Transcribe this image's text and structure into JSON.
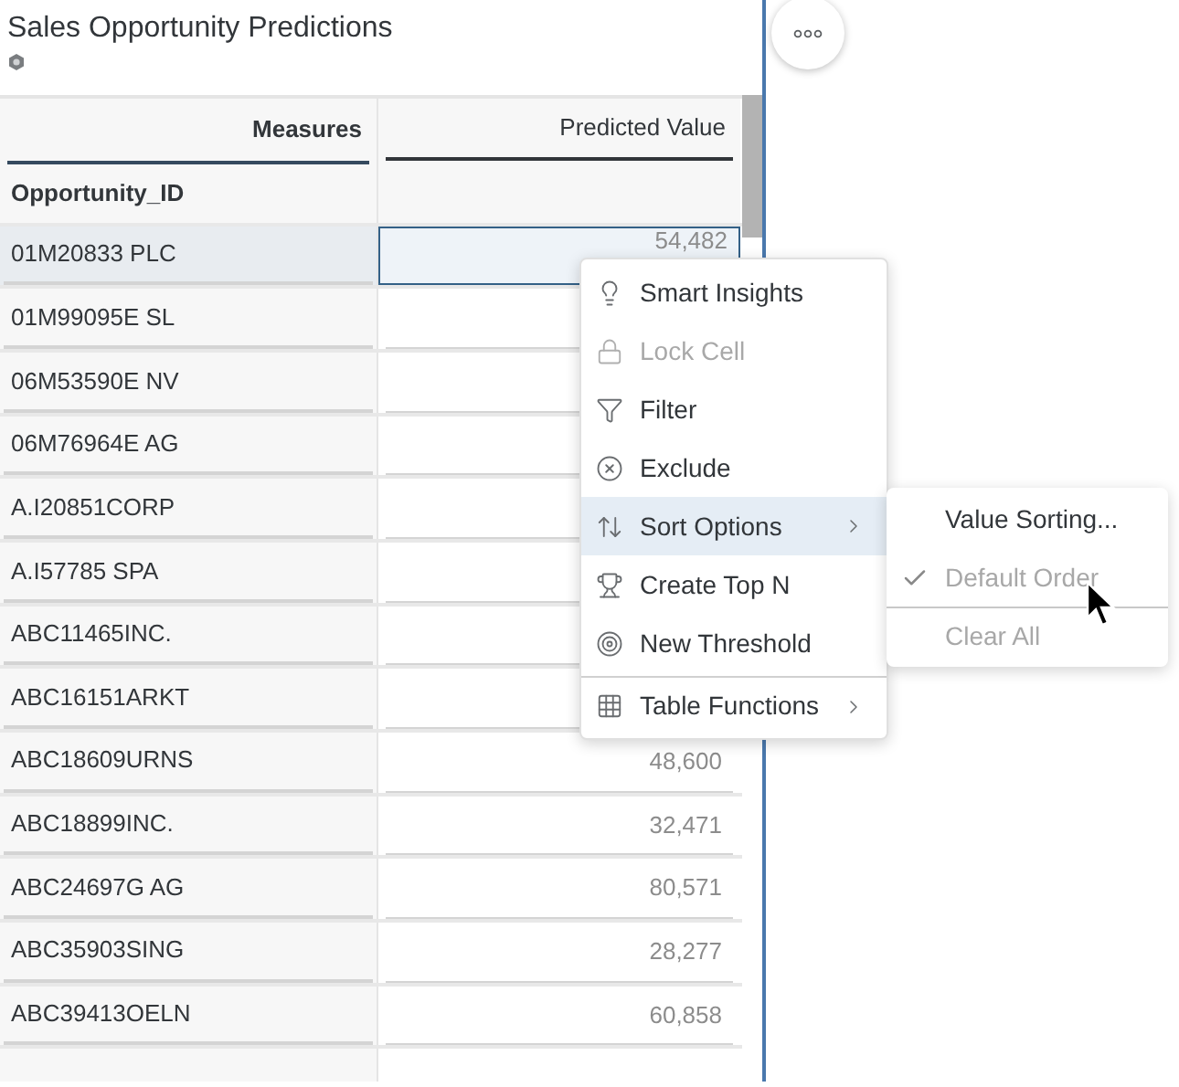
{
  "widget": {
    "title": "Sales Opportunity Predictions"
  },
  "table": {
    "corner_label": "Measures",
    "columns": [
      "Predicted Value"
    ],
    "row_dimension": "Opportunity_ID",
    "rows": [
      {
        "id": "01M20833 PLC",
        "value": "54,482",
        "selected": true
      },
      {
        "id": "01M99095E SL",
        "selected": false
      },
      {
        "id": "06M53590E NV",
        "selected": false
      },
      {
        "id": "06M76964E AG",
        "selected": false
      },
      {
        "id": "A.I20851CORP",
        "selected": false
      },
      {
        "id": "A.I57785 SPA",
        "selected": false
      },
      {
        "id": "ABC11465INC.",
        "selected": false
      },
      {
        "id": "ABC16151ARKT",
        "selected": false
      },
      {
        "id": "ABC18609URNS",
        "value": "48,600",
        "selected": false
      },
      {
        "id": "ABC18899INC.",
        "value": "32,471",
        "selected": false
      },
      {
        "id": "ABC24697G AG",
        "value": "80,571",
        "selected": false
      },
      {
        "id": "ABC35903SING",
        "value": "28,277",
        "selected": false
      },
      {
        "id": "ABC39413OELN",
        "value": "60,858",
        "selected": false
      }
    ]
  },
  "context_menu": {
    "items": [
      {
        "label": "Smart Insights",
        "kind": "bulb",
        "disabled": false,
        "selected": false,
        "submenu": false
      },
      {
        "label": "Lock Cell",
        "kind": "lock",
        "disabled": true,
        "selected": false,
        "submenu": false
      },
      {
        "label": "Filter",
        "kind": "filter",
        "disabled": false,
        "selected": false,
        "submenu": false
      },
      {
        "label": "Exclude",
        "kind": "exclude",
        "disabled": false,
        "selected": false,
        "submenu": false
      },
      {
        "label": "Sort Options",
        "kind": "sort",
        "disabled": false,
        "selected": true,
        "submenu": true
      },
      {
        "label": "Create Top N",
        "kind": "trophy",
        "disabled": false,
        "selected": false,
        "submenu": false
      },
      {
        "label": "New Threshold",
        "kind": "target",
        "disabled": false,
        "selected": false,
        "submenu": false
      },
      {
        "label": "Table Functions",
        "kind": "table",
        "disabled": false,
        "selected": false,
        "submenu": true,
        "divider_before": true
      }
    ]
  },
  "submenu": {
    "items": [
      {
        "label": "Value Sorting...",
        "checked": false,
        "disabled": false
      },
      {
        "label": "Default Order",
        "checked": true,
        "disabled": true
      },
      {
        "label": "Clear All",
        "checked": false,
        "disabled": true,
        "divider_before": true
      }
    ]
  }
}
